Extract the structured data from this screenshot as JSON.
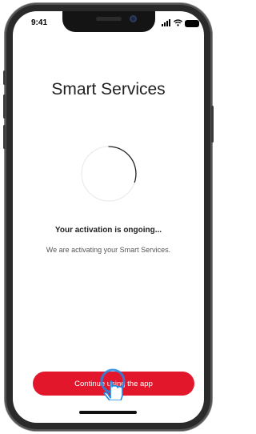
{
  "status_bar": {
    "time": "9:41"
  },
  "page": {
    "title": "Smart Services",
    "status_heading": "Your activation is ongoing...",
    "status_subtext": "We are activating your Smart Services."
  },
  "actions": {
    "continue_label": "Continue using the app"
  },
  "colors": {
    "accent": "#e3172c",
    "spinner_track": "#e6e6e6",
    "spinner_arc": "#222222"
  },
  "icons": [
    "signal-icon",
    "wifi-icon",
    "battery-icon",
    "loading-spinner",
    "hand-pointer-icon"
  ]
}
